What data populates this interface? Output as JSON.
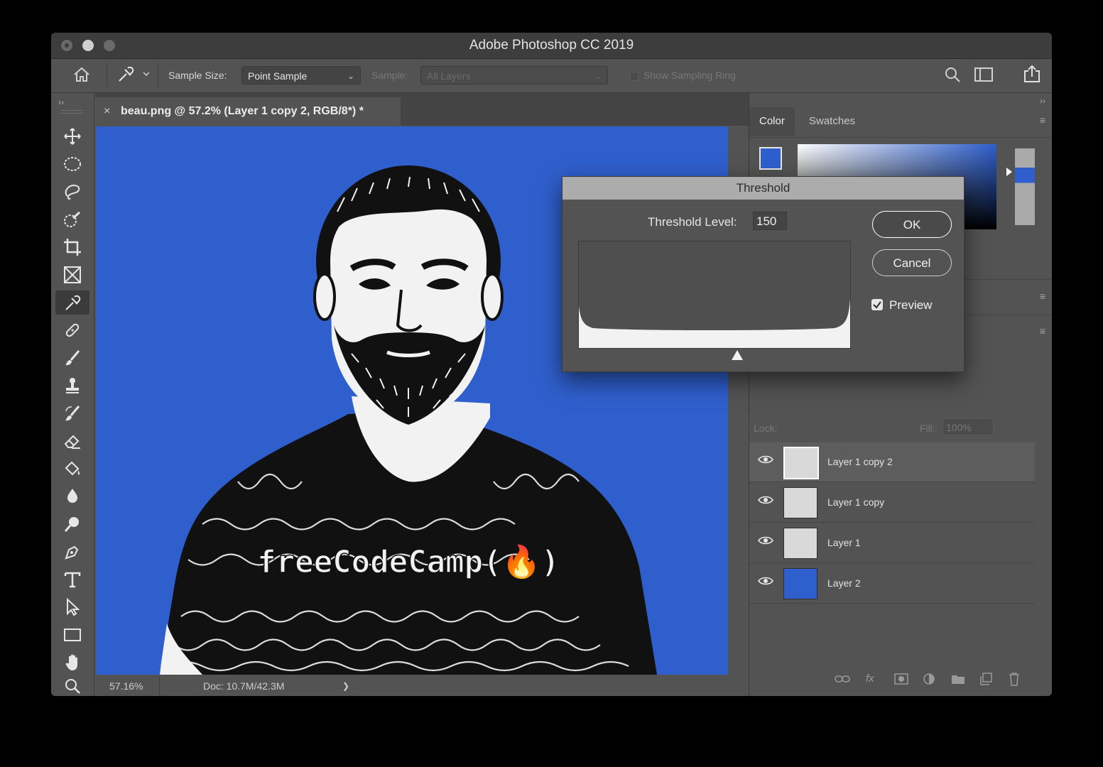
{
  "window": {
    "title": "Adobe Photoshop CC 2019"
  },
  "options_bar": {
    "sample_size_label": "Sample Size:",
    "sample_size_value": "Point Sample",
    "sample_label": "Sample:",
    "sample_value": "All Layers",
    "show_sampling_ring": "Show Sampling Ring"
  },
  "document": {
    "tab_title": "beau.png @ 57.2% (Layer 1 copy 2, RGB/8*) *",
    "shirt_text": "freeCodeCamp(🔥)"
  },
  "status_bar": {
    "zoom": "57.16%",
    "doc_info": "Doc: 10.7M/42.3M",
    "arrow": "❯"
  },
  "panel": {
    "tabs": [
      "Color",
      "Swatches"
    ],
    "foreground_color": "#2f5fcc",
    "lock_label": "Lock:",
    "fill_label": "Fill:",
    "fill_value": "100%",
    "layers": [
      {
        "name": "Layer 1 copy 2",
        "selected": true
      },
      {
        "name": "Layer 1 copy",
        "selected": false
      },
      {
        "name": "Layer 1",
        "selected": false
      },
      {
        "name": "Layer 2",
        "selected": false,
        "fill": "#2f5fcc"
      }
    ]
  },
  "threshold_dialog": {
    "title": "Threshold",
    "level_label": "Threshold Level:",
    "level_value": "150",
    "ok_label": "OK",
    "cancel_label": "Cancel",
    "preview_label": "Preview",
    "preview_checked": true
  },
  "colors": {
    "canvas_blue": "#2f5fcc",
    "ui_gray": "#535353"
  }
}
